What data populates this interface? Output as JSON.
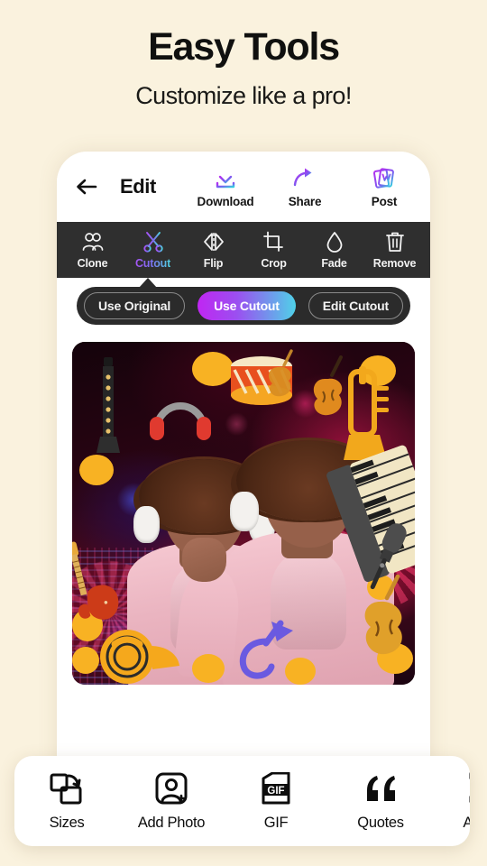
{
  "promo": {
    "title": "Easy Tools",
    "subtitle": "Customize like a pro!",
    "background_color": "#faf2de"
  },
  "appbar": {
    "back_icon": "back-arrow-icon",
    "title": "Edit",
    "actions": [
      {
        "icon": "download-icon",
        "label": "Download"
      },
      {
        "icon": "share-icon",
        "label": "Share"
      },
      {
        "icon": "post-icon",
        "label": "Post"
      }
    ]
  },
  "toolstrip": {
    "background_color": "#2f2f2f",
    "active_index": 1,
    "tools": [
      {
        "icon": "clone-people-icon",
        "label": "Clone",
        "active": false
      },
      {
        "icon": "scissors-icon",
        "label": "Cutout",
        "active": true
      },
      {
        "icon": "flip-icon",
        "label": "Flip",
        "active": false
      },
      {
        "icon": "crop-icon",
        "label": "Crop",
        "active": false
      },
      {
        "icon": "droplet-icon",
        "label": "Fade",
        "active": false
      },
      {
        "icon": "trash-icon",
        "label": "Remove",
        "active": false
      }
    ]
  },
  "segment_control": {
    "background_color": "#2b2b2b",
    "selected": "Use Cutout",
    "gradient_from": "#c026f2",
    "gradient_to": "#4fd1e8",
    "options": [
      {
        "label": "Use Original",
        "selected": false
      },
      {
        "label": "Use Cutout",
        "selected": true
      },
      {
        "label": "Edit Cutout",
        "selected": false
      }
    ]
  },
  "canvas": {
    "description": "Music club photo collage with two cloned women wearing headphones and pink hoodies",
    "sticker_color": "#f8b223",
    "stickers": [
      "clarinet",
      "headphones",
      "drum",
      "violin",
      "trumpet",
      "piano-keyboard",
      "electric-guitar",
      "french-horn",
      "purple-trumpet",
      "double-bass",
      "microphone",
      "acoustic-guitar"
    ]
  },
  "bottombar": {
    "items": [
      {
        "icon": "sizes-icon",
        "label": "Sizes"
      },
      {
        "icon": "add-photo-icon",
        "label": "Add Photo"
      },
      {
        "icon": "gif-icon",
        "label": "GIF"
      },
      {
        "icon": "quotes-icon",
        "label": "Quotes"
      },
      {
        "icon": "add-text-icon",
        "label": "Add Te"
      }
    ]
  }
}
